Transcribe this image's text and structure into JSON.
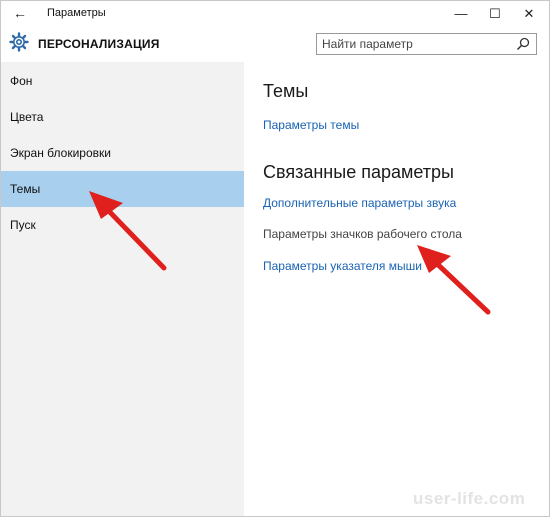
{
  "window": {
    "title": "Параметры",
    "back_glyph": "←",
    "minimize_glyph": "—",
    "maximize_glyph": "☐",
    "close_glyph": "✕"
  },
  "header": {
    "title": "ПЕРСОНАЛИЗАЦИЯ",
    "icon": "gear-icon"
  },
  "search": {
    "placeholder": "Найти параметр",
    "icon": "search-icon"
  },
  "sidebar": {
    "items": [
      {
        "label": "Фон"
      },
      {
        "label": "Цвета"
      },
      {
        "label": "Экран блокировки"
      },
      {
        "label": "Темы",
        "selected": true
      },
      {
        "label": "Пуск"
      }
    ]
  },
  "main": {
    "section1_title": "Темы",
    "theme_settings_link": "Параметры темы",
    "section2_title": "Связанные параметры",
    "related": [
      {
        "label": "Дополнительные параметры звука",
        "style": "link"
      },
      {
        "label": "Параметры значков рабочего стола",
        "style": "plain"
      },
      {
        "label": "Параметры указателя мыши",
        "style": "link"
      }
    ]
  },
  "annotations": {
    "arrow_color": "#e0201c"
  },
  "watermark": "user-life.com",
  "colors": {
    "selected_bg": "#a8cfee",
    "link": "#1a63b4",
    "sidebar_bg": "#f2f2f2"
  }
}
